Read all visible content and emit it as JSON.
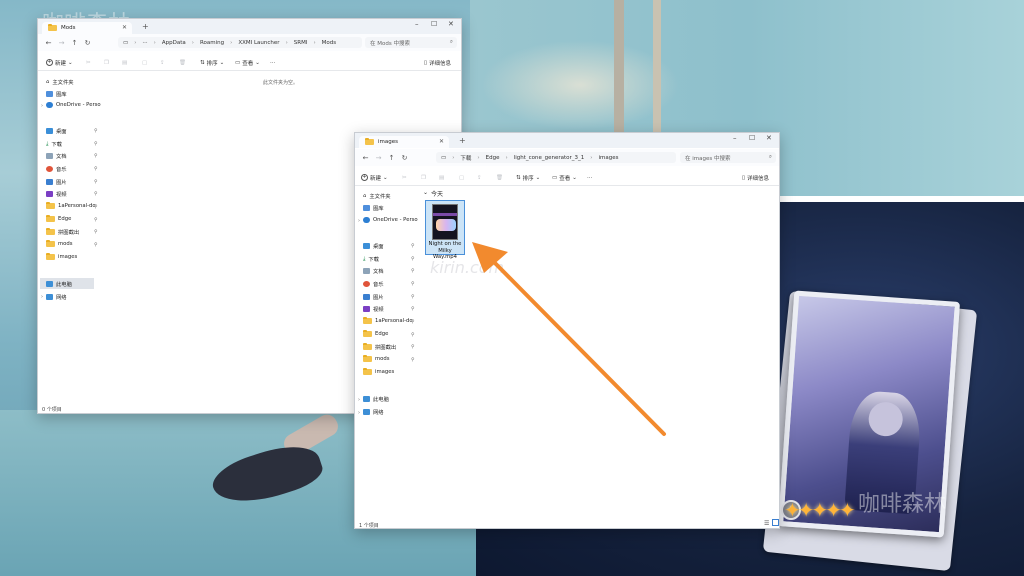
{
  "colors": {
    "accent": "#4a90d9",
    "arrow": "#f28a2e",
    "folder": "#f4c34a",
    "star": "#ffb43a"
  },
  "window_mods": {
    "tab_title": "Mods",
    "breadcrumb": [
      "AppData",
      "Roaming",
      "XXMI Launcher",
      "SRMI",
      "Mods"
    ],
    "breadcrumb_overflow": "···",
    "search_placeholder": "在 Mods 中搜索",
    "toolbar": {
      "new_label": "新建",
      "sort_label": "排序",
      "view_label": "查看",
      "more_label": "···",
      "details_label": "详细信息"
    },
    "empty_message": "此文件夹为空。",
    "status_text": "0 个项目",
    "sidebar": {
      "home": "主文件夹",
      "gallery": "图库",
      "onedrive": "OneDrive - Perso",
      "quick": [
        "桌面",
        "下载",
        "文档",
        "音乐",
        "图片",
        "视频",
        "1aPersonal-do",
        "Edge",
        "拼图截出",
        "mods",
        "images"
      ],
      "this_pc": "此电脑",
      "network": "网络"
    }
  },
  "window_images": {
    "tab_title": "images",
    "breadcrumb": [
      "下载",
      "Edge",
      "light_cone_generator_3_1",
      "images"
    ],
    "search_placeholder": "在 images 中搜索",
    "toolbar": {
      "new_label": "新建",
      "sort_label": "排序",
      "view_label": "查看",
      "more_label": "···",
      "details_label": "详细信息"
    },
    "group_header": "今天",
    "file": {
      "name_line1": "Night on the",
      "name_line2": "Milky Way.mp4"
    },
    "status_text": "1 个项目",
    "sidebar": {
      "home": "主文件夹",
      "gallery": "图库",
      "onedrive": "OneDrive - Perso",
      "quick": [
        "桌面",
        "下载",
        "文档",
        "音乐",
        "图片",
        "视频",
        "1aPersonal-do",
        "Edge",
        "拼图截出",
        "mods",
        "images"
      ],
      "this_pc": "此电脑",
      "network": "网络"
    }
  },
  "watermarks": {
    "top_left": "咖啡森林",
    "bottom_right": "咖啡森林",
    "center": "kirin.com"
  }
}
